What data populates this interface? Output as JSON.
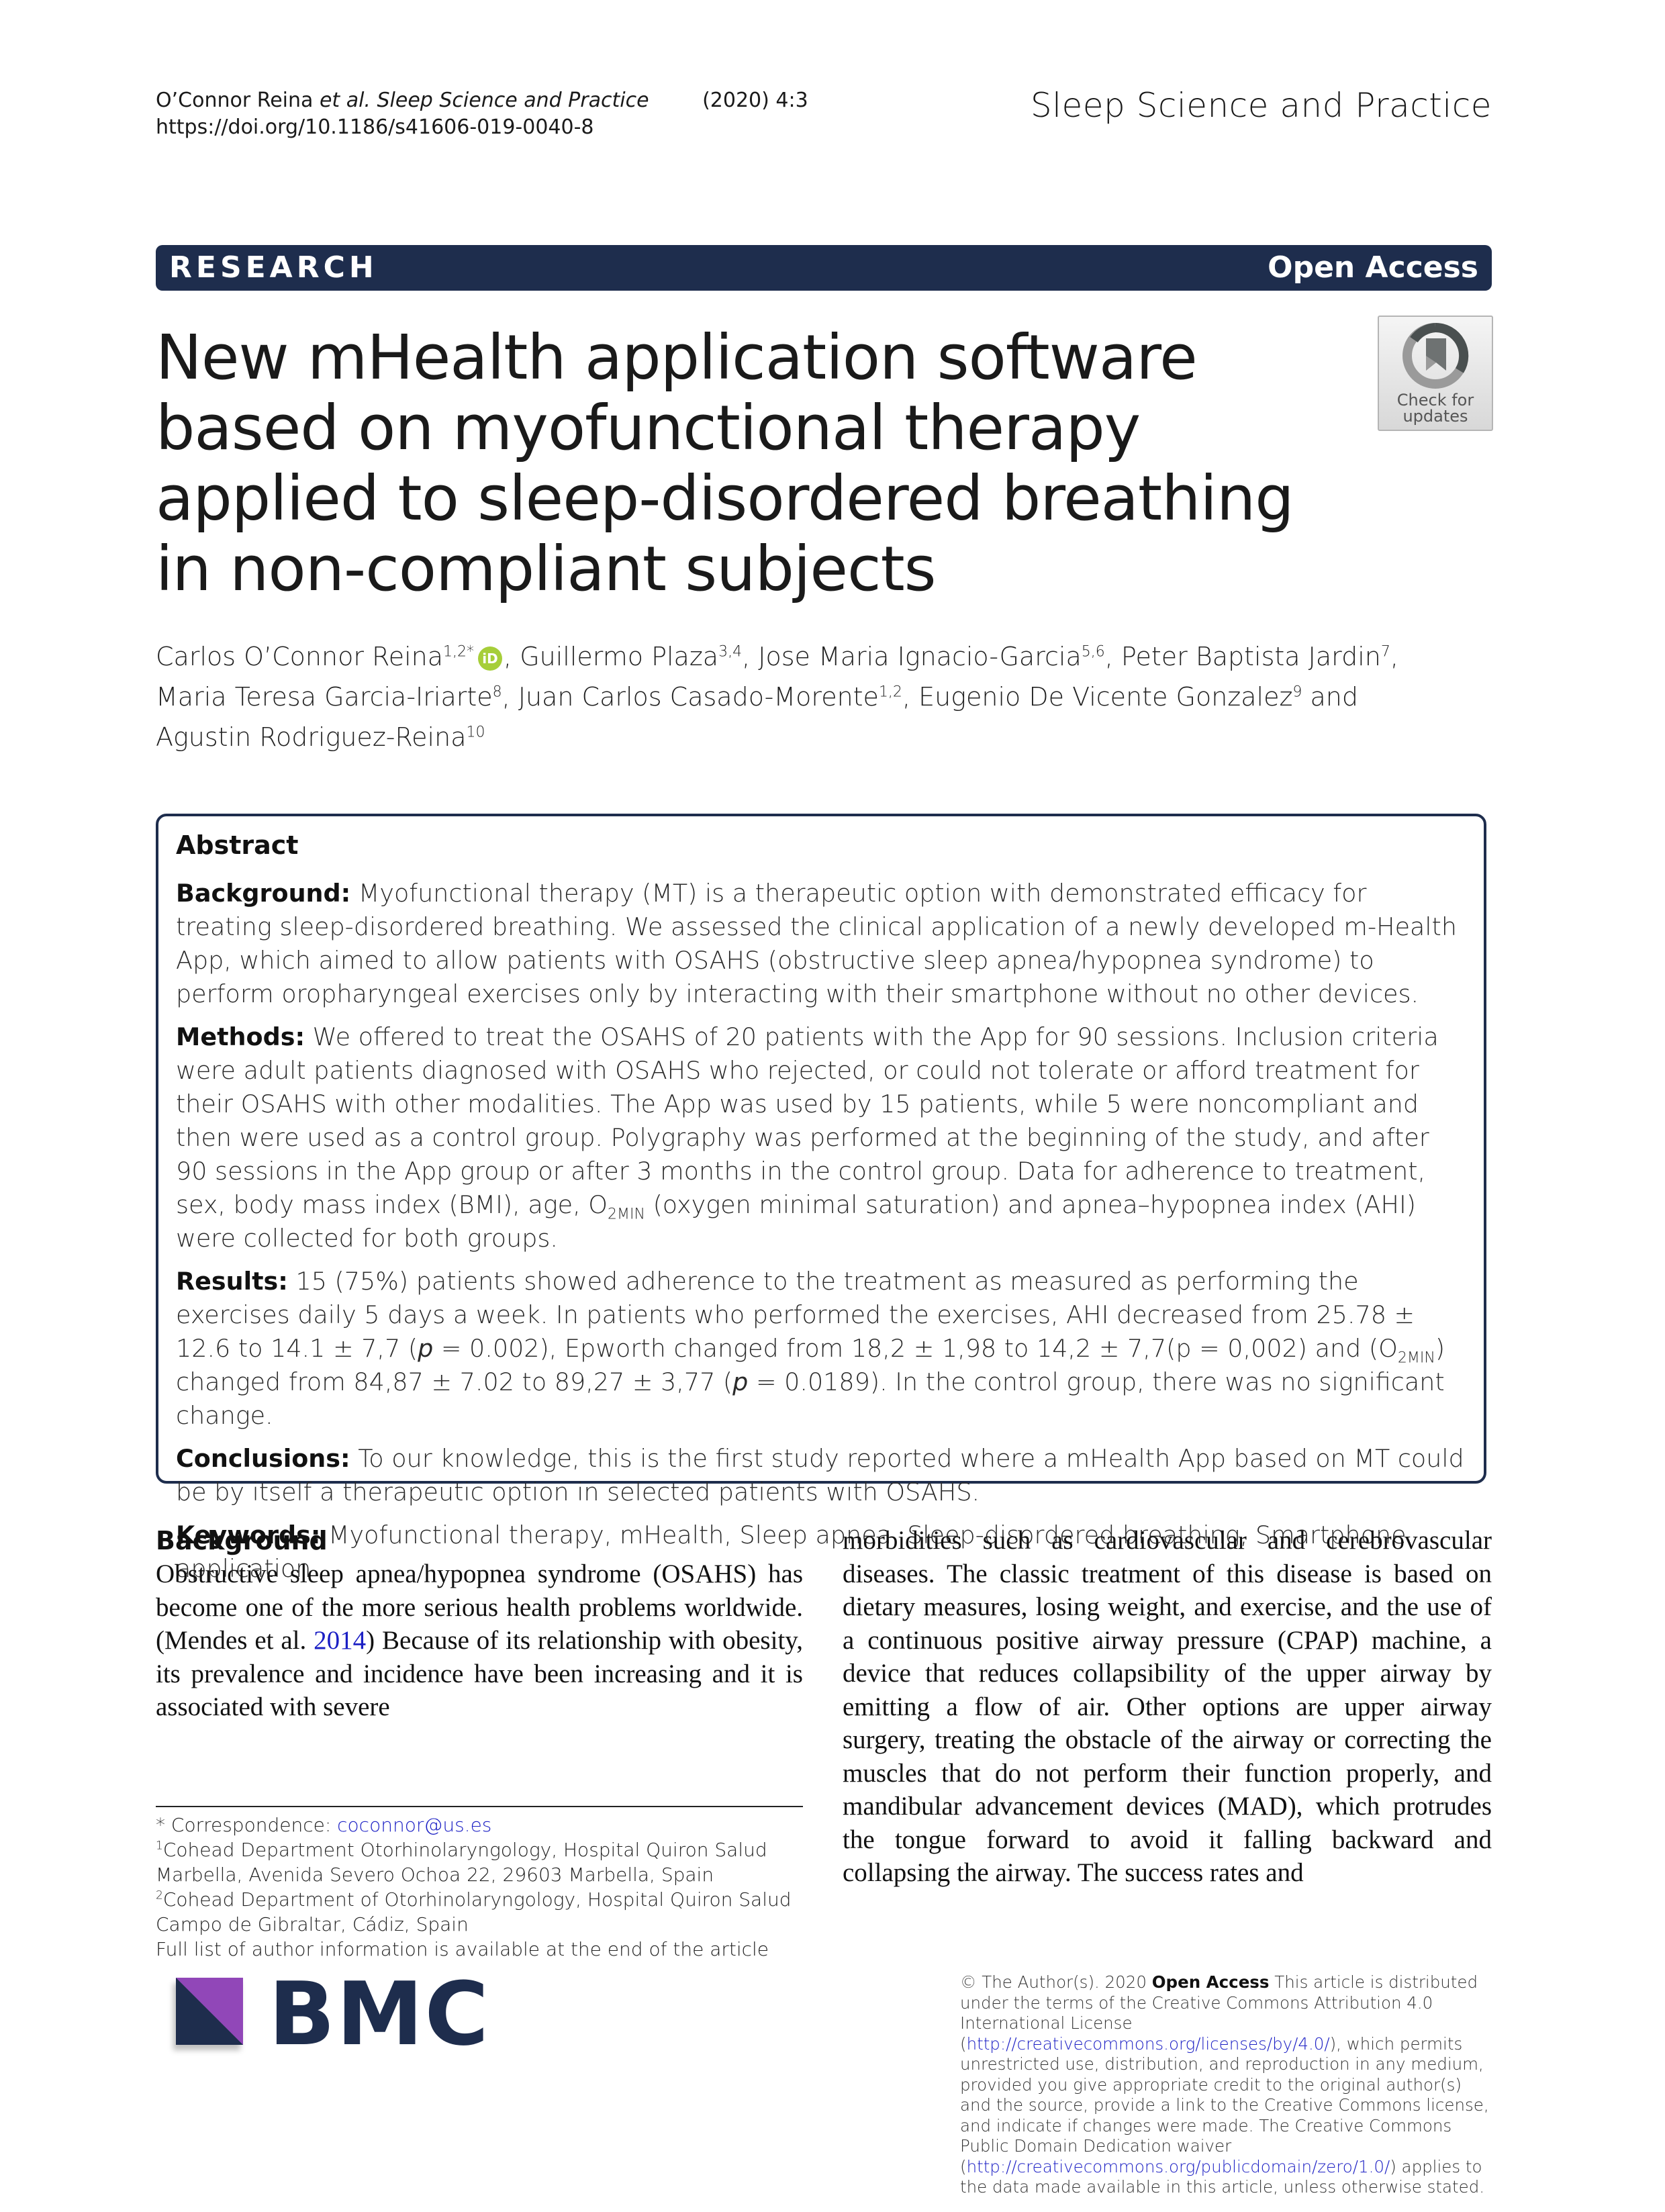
{
  "running_header": {
    "authors": "O’Connor Reina",
    "etal": "et al.",
    "journal_italic": "Sleep Science and Practice",
    "citation": "(2020) 4:3",
    "doi": "https://doi.org/10.1186/s41606-019-0040-8"
  },
  "journal_name": "Sleep Science and Practice",
  "banner": {
    "article_type": "RESEARCH",
    "access": "Open Access"
  },
  "title": "New mHealth application software based on myofunctional therapy applied to sleep-disordered breathing in non-compliant subjects",
  "check_for_updates": {
    "line1": "Check for",
    "line2": "updates",
    "icon": "bookmark-circle-icon"
  },
  "authors": [
    {
      "name": "Carlos O’Connor Reina",
      "sup": "1,2*",
      "orcid": true
    },
    {
      "name": "Guillermo Plaza",
      "sup": "3,4"
    },
    {
      "name": "Jose Maria Ignacio-Garcia",
      "sup": "5,6"
    },
    {
      "name": "Peter Baptista Jardin",
      "sup": "7"
    },
    {
      "name": "Maria Teresa Garcia-Iriarte",
      "sup": "8"
    },
    {
      "name": "Juan Carlos Casado-Morente",
      "sup": "1,2"
    },
    {
      "name": "Eugenio De Vicente Gonzalez",
      "sup": "9"
    },
    {
      "name": "Agustin Rodriguez-Reina",
      "sup": "10"
    }
  ],
  "authors_conj": "and",
  "orcid_label": "iD",
  "abstract": {
    "heading": "Abstract",
    "background_label": "Background:",
    "background": "Myofunctional therapy (MT) is a therapeutic option with demonstrated efficacy for treating sleep-disordered breathing. We assessed the clinical application of a newly developed m-Health App, which aimed to allow patients with OSAHS (obstructive sleep apnea/hypopnea syndrome) to perform oropharyngeal exercises only by interacting with their smartphone without no other devices.",
    "methods_label": "Methods:",
    "methods_a": "We offered to treat the OSAHS of 20 patients with the App for 90 sessions. Inclusion criteria were adult patients diagnosed with OSAHS who rejected, or could not tolerate or afford treatment for their OSAHS with other modalities. The App was used by 15 patients, while 5 were noncompliant and then were used as a control group. Polygraphy was performed at the beginning of the study, and after 90 sessions in the App group or after 3 months in the control group. Data for adherence to treatment, sex, body mass index (BMI), age, O",
    "methods_sub": "2MIN",
    "methods_b": " (oxygen minimal saturation) and apnea–hypopnea index (AHI) were collected for both groups.",
    "results_label": "Results:",
    "results_a": "15 (75%) patients showed adherence to the treatment as measured as performing the exercises daily 5 days a week. In patients who performed the exercises, AHI decreased from 25.78 ± 12.6 to 14.1 ± 7,7 (",
    "results_p1": "p",
    "results_b": " = 0.002), Epworth changed from 18,2 ± 1,98 to 14,2 ± 7,7(p = 0,002) and (O",
    "results_sub": "2MIN",
    "results_c": ") changed from 84,87 ± 7.02 to 89,27 ± 3,77 (",
    "results_p2": "p",
    "results_d": " = 0.0189). In the control group, there was no significant change.",
    "conclusions_label": "Conclusions:",
    "conclusions": "To our knowledge, this is the first study reported where a mHealth App based on MT could be by itself a therapeutic option in selected patients with OSAHS.",
    "keywords_label": "Keywords:",
    "keywords": "Myofunctional therapy, mHealth, Sleep apnea, Sleep-disordered breathing, Smartphone application"
  },
  "body": {
    "section_heading": "Background",
    "left_a": "Obstructive sleep apnea/hypopnea syndrome (OSAHS) has become one of the more serious health problems worldwide.(Mendes et al. ",
    "left_ref": "2014",
    "left_b": ") Because of its relationship with obesity, its prevalence and incidence have been increasing and it is associated with severe",
    "right": "morbidities such as cardiovascular and cerebrovascular diseases. The classic treatment of this disease is based on dietary measures, losing weight, and exercise, and the use of a continuous positive airway pressure (CPAP) machine, a device that reduces collapsibility of the upper airway by emitting a flow of air. Other options are upper airway surgery, treating the obstacle of the airway or correcting the muscles that do not perform their function properly, and mandibular advancement devices (MAD), which protrudes the tongue forward to avoid it falling backward and collapsing the airway. The success rates and"
  },
  "footnotes": {
    "corr_label": "* Correspondence: ",
    "corr_email": "coconnor@us.es",
    "aff1_sup": "1",
    "aff1": "Cohead Department Otorhinolaryngology, Hospital Quiron Salud Marbella, Avenida Severo Ochoa 22, 29603 Marbella, Spain",
    "aff2_sup": "2",
    "aff2": "Cohead Department of Otorhinolaryngology, Hospital Quiron Salud Campo de Gibraltar, Cádiz, Spain",
    "full_list": "Full list of author information is available at the end of the article"
  },
  "publisher": {
    "logo_text": "BMC",
    "colors": {
      "navy": "#1e2d4d",
      "purple": "#9147b8"
    }
  },
  "license": {
    "copyright": "© The Author(s). 2020 ",
    "oa_label": "Open Access",
    "text_a": " This article is distributed under the terms of the Creative Commons Attribution 4.0 International License (",
    "link1": "http://creativecommons.org/licenses/by/4.0/",
    "text_b": "), which permits unrestricted use, distribution, and reproduction in any medium, provided you give appropriate credit to the original author(s) and the source, provide a link to the Creative Commons license, and indicate if changes were made. The Creative Commons Public Domain Dedication waiver (",
    "link2": "http://creativecommons.org/publicdomain/zero/1.0/",
    "text_c": ") applies to the data made available in this article, unless otherwise stated."
  },
  "colors": {
    "banner": "#1e2d4d",
    "link": "#1b1fc4",
    "orcid": "#a6ce39"
  }
}
